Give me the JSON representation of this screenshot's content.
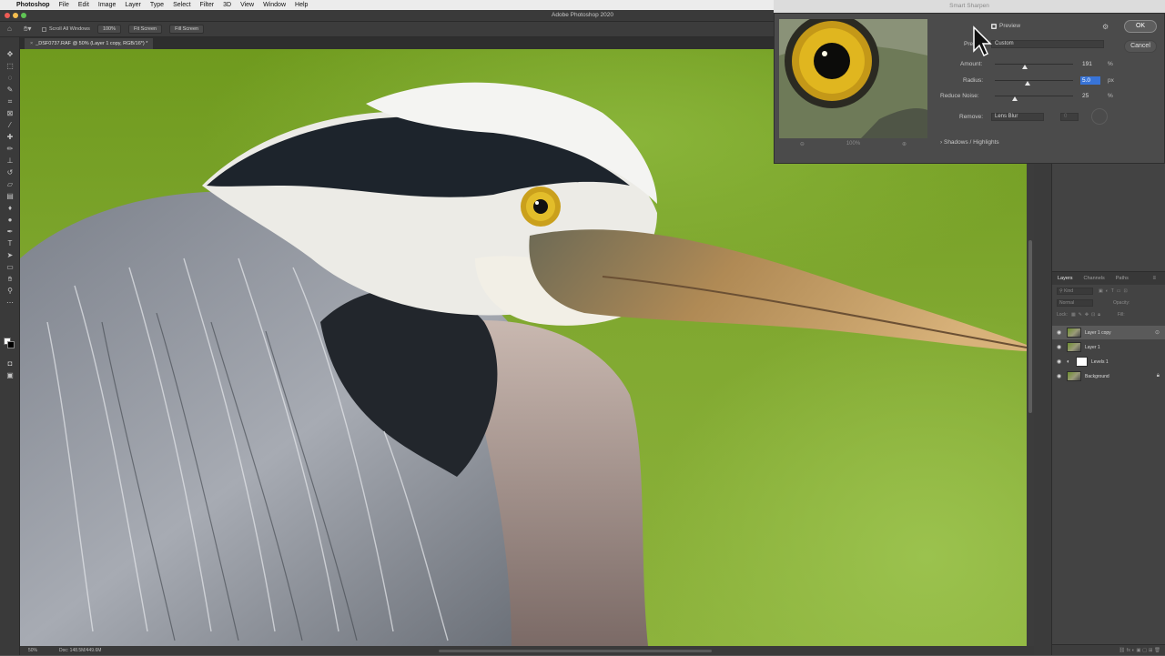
{
  "menubar": {
    "app_name": "Photoshop",
    "items": [
      "File",
      "Edit",
      "Image",
      "Layer",
      "Type",
      "Select",
      "Filter",
      "3D",
      "View",
      "Window",
      "Help"
    ]
  },
  "window": {
    "title": "Adobe Photoshop 2020"
  },
  "options_bar": {
    "scroll_all_label": "Scroll All Windows",
    "zoom_100_label": "100%",
    "fit_screen_label": "Fit Screen",
    "fill_screen_label": "Fill Screen"
  },
  "document": {
    "tab_title": "_DSF0737.RAF @ 50% (Layer 1 copy, RGB/16*) *"
  },
  "status": {
    "zoom": "50%",
    "doc_size": "Doc: 148.5M/449.6M"
  },
  "dialog": {
    "title": "Smart Sharpen",
    "preview_label": "Preview",
    "preview_checked": true,
    "preview_zoom": "100%",
    "preset_label": "Preset:",
    "preset_value": "Custom",
    "amount_label": "Amount:",
    "amount_value": "191",
    "amount_unit": "%",
    "amount_fraction": 0.38,
    "radius_label": "Radius:",
    "radius_value": "5.0",
    "radius_unit": "px",
    "radius_fraction": 0.42,
    "noise_label": "Reduce Noise:",
    "noise_value": "25",
    "noise_unit": "%",
    "noise_fraction": 0.25,
    "remove_label": "Remove:",
    "remove_value": "Lens Blur",
    "angle_value": "0",
    "shadows_label": "Shadows / Highlights",
    "ok_label": "OK",
    "cancel_label": "Cancel"
  },
  "layers_panel": {
    "tabs": [
      "Layers",
      "Channels",
      "Paths"
    ],
    "kind_label": "Kind",
    "blend_mode": "Normal",
    "opacity_label": "Opacity:",
    "lock_label": "Lock:",
    "fill_label": "Fill:",
    "layers": [
      {
        "name": "Layer 1 copy",
        "selected": true
      },
      {
        "name": "Layer 1",
        "selected": false
      },
      {
        "name": "Levels 1",
        "selected": false
      },
      {
        "name": "Background",
        "selected": false
      }
    ]
  },
  "colors": {
    "highlight": "#3874d8",
    "panel_bg": "#434343",
    "background_green": "#80a830"
  }
}
